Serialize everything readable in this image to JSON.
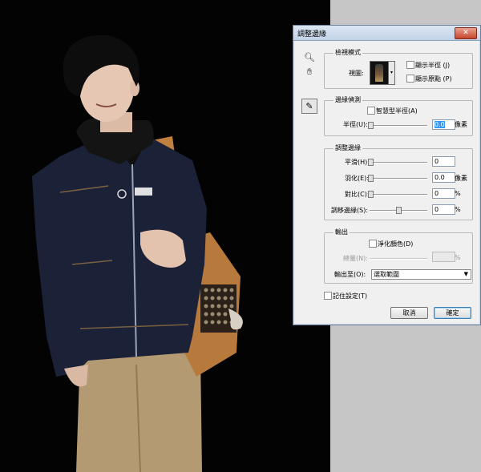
{
  "dialog": {
    "title": "調整邊緣",
    "close_icon": "close-icon",
    "view_mode": {
      "legend": "檢視模式",
      "view_label": "視圖:",
      "show_radius": "顯示半徑 (J)",
      "show_original": "顯示原點 (P)"
    },
    "edge_detection": {
      "legend": "邊緣偵測",
      "smart_radius": "智慧型半徑(A)",
      "radius_label": "半徑(U):",
      "radius_value": "0.0",
      "radius_unit": "像素"
    },
    "adjust_edge": {
      "legend": "調整邊緣",
      "smooth_label": "平滑(H):",
      "smooth_value": "0",
      "feather_label": "羽化(E):",
      "feather_value": "0.0",
      "feather_unit": "像素",
      "contrast_label": "對比(C):",
      "contrast_value": "0",
      "contrast_unit": "%",
      "shift_label": "調移邊緣(S):",
      "shift_value": "0",
      "shift_unit": "%"
    },
    "output": {
      "legend": "輸出",
      "decontaminate": "淨化顏色(D)",
      "amount_label": "總量(N):",
      "amount_unit": "%",
      "output_to_label": "輸出至(O):",
      "output_to_value": "選取範圍"
    },
    "remember": "記住設定(T)",
    "cancel": "取消",
    "ok": "確定"
  }
}
